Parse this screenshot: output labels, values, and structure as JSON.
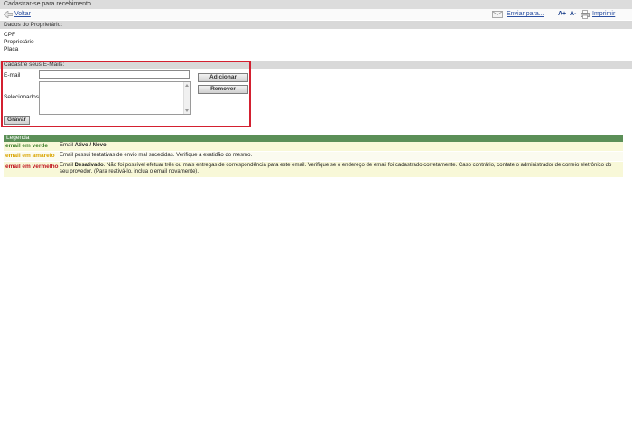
{
  "window": {
    "title": "Cadastrar-se para recebimento"
  },
  "toolbar": {
    "back_label": "Voltar",
    "send_label": "Enviar para...",
    "font_increase_label": "A+",
    "font_decrease_label": "A-",
    "print_label": "Imprimir"
  },
  "owner": {
    "header": "Dados do Proprietário:",
    "fields": [
      "CPF",
      "Proprietário",
      "Placa"
    ]
  },
  "emails": {
    "header": "Cadastre seus E-Mails:",
    "email_label": "E-mail",
    "email_value": "",
    "selected_label": "Selecionados",
    "add_button": "Adicionar",
    "remove_button": "Remover",
    "save_button": "Gravar"
  },
  "legend": {
    "header": "Legenda",
    "rows": [
      {
        "key": "email em verde",
        "desc_prefix": "Email ",
        "desc_bold": "Ativo / Novo",
        "desc_rest": ""
      },
      {
        "key": "email em amarelo",
        "desc_prefix": "",
        "desc_bold": "",
        "desc_rest": "Email possui tentativas de envio mal sucedidas. Verifique a exatidão do mesmo."
      },
      {
        "key": "email em vermelho",
        "desc_prefix": "Email ",
        "desc_bold": "Desativado",
        "desc_rest": ". Não foi possível efetuar três ou mais entregas de correspondência para este email. Verifique se o endereço de email foi cadastrado corretamente. Caso contrário, contate o administrador de correio eletrônico do seu provedor. (Para reativá-lo, inclua o email novamente)."
      }
    ]
  },
  "colors": {
    "highlight": "#d32030",
    "legend_header": "#5b8f57",
    "green": "#3f7f2a",
    "yellow": "#d9a400",
    "red": "#c0141e"
  }
}
